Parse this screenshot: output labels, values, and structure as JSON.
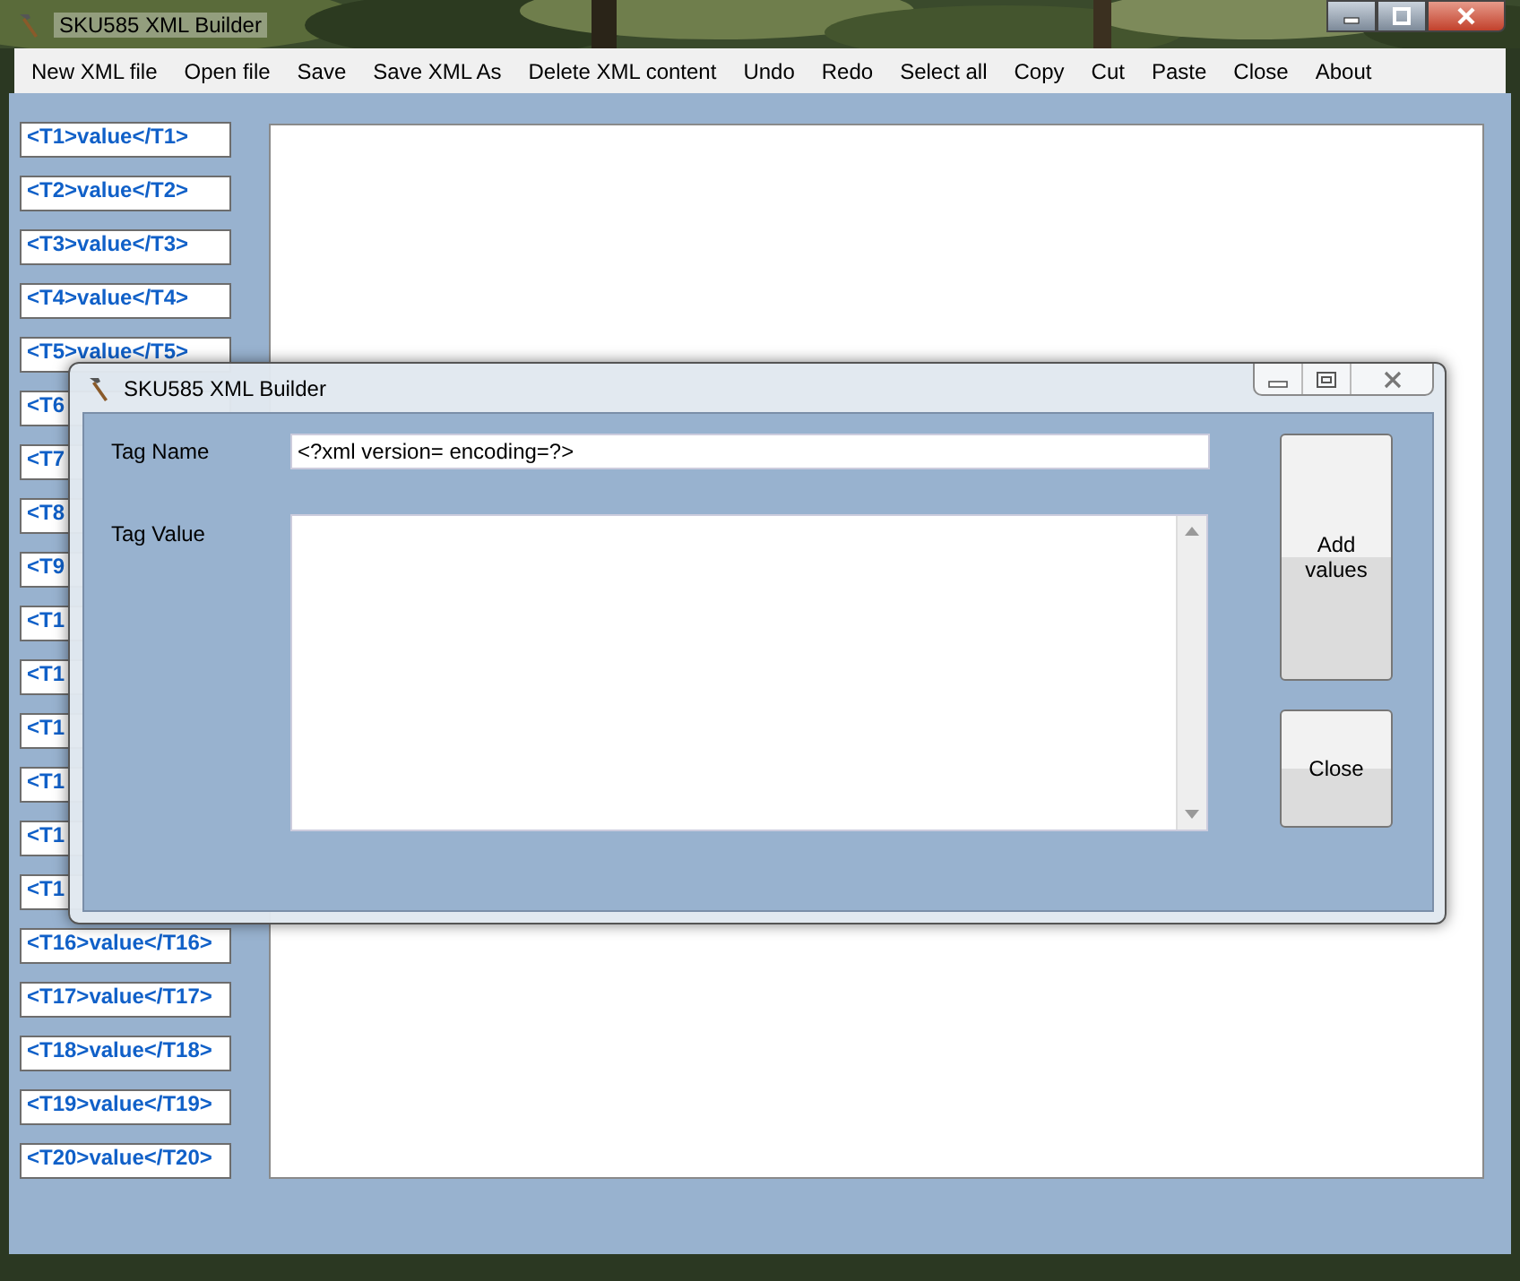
{
  "window": {
    "title": "SKU585 XML Builder"
  },
  "menu": [
    "New XML file",
    "Open file",
    "Save",
    "Save XML As",
    "Delete XML content",
    "Undo",
    "Redo",
    "Select all",
    "Copy",
    "Cut",
    "Paste",
    "Close",
    "About"
  ],
  "tag_buttons": [
    "<T1>value</T1>",
    "<T2>value</T2>",
    "<T3>value</T3>",
    "<T4>value</T4>",
    "<T5>value</T5>",
    "<T6",
    "<T7",
    "<T8",
    "<T9",
    "<T1",
    "<T1",
    "<T1",
    "<T1",
    "<T1",
    "<T1",
    "<T16>value</T16>",
    "<T17>value</T17>",
    "<T18>value</T18>",
    "<T19>value</T19>",
    "<T20>value</T20>"
  ],
  "dialog": {
    "title": "SKU585 XML Builder",
    "tag_name": {
      "label": "Tag Name",
      "value": "<?xml version= encoding=?>"
    },
    "tag_value": {
      "label": "Tag Value"
    },
    "buttons": [
      "Add values",
      "Close"
    ]
  }
}
